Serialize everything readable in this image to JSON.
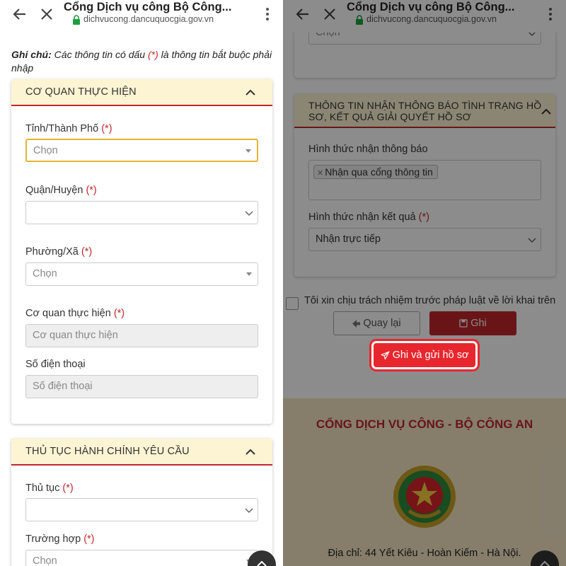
{
  "browser": {
    "title": "Cổng Dịch vụ công Bộ Công...",
    "url": "dichvucong.dancuquocgia.gov.vn"
  },
  "note": {
    "label": "Ghi chú:",
    "text_before": " Các thông tin có dấu ",
    "marker": "(*)",
    "text_after": " là thông tin bắt buộc phải nhập"
  },
  "required_marker": "(*)",
  "section_agency": {
    "title": "CƠ QUAN THỰC HIỆN",
    "province_label": "Tỉnh/Thành Phố",
    "province_placeholder": "Chọn",
    "district_label": "Quận/Huyện",
    "ward_label": "Phường/Xã",
    "ward_placeholder": "Chọn",
    "agency_label": "Cơ quan thực hiện",
    "agency_placeholder": "Cơ quan thực hiện",
    "phone_label": "Số điện thoại",
    "phone_placeholder": "Số điện thoại"
  },
  "section_procedure": {
    "title": "THỦ TỤC HÀNH CHÍNH YÊU CẦU",
    "procedure_label": "Thủ tục",
    "case_label": "Trường hợp",
    "case_placeholder": "Chọn"
  },
  "right_top_select_value": "Chọn",
  "section_notify": {
    "title_line1": "THÔNG TIN NHẬN THÔNG BÁO TÌNH TRẠNG HỒ",
    "title_line2": "SƠ, KẾT QUẢ GIẢI QUYẾT HỒ SƠ",
    "notify_method_label": "Hình thức nhận thông báo",
    "notify_tag": "Nhận qua cổng thông tin",
    "result_method_label": "Hình thức nhận kết quả",
    "result_method_value": "Nhận trực tiếp"
  },
  "agreement_text": "Tôi xin chịu trách nhiệm trước pháp luật về lời khai trên",
  "buttons": {
    "back": "Quay lại",
    "save": "Ghi",
    "save_and_submit": "Ghi và gửi hồ sơ"
  },
  "footer": {
    "title": "CỔNG DỊCH VỤ CÔNG - BỘ CÔNG AN",
    "address": "Địa chỉ: 44 Yết Kiêu - Hoàn Kiếm - Hà Nội."
  },
  "colors": {
    "accent_red": "#c0272d",
    "header_cream": "#fdf4d3",
    "focus_yellow": "#e2b333",
    "submit_red": "#e8262e"
  },
  "icons": [
    "arrow-back-icon",
    "close-icon",
    "lock-icon",
    "more-vert-icon",
    "chevron-up-icon",
    "caret-down-icon",
    "chevron-down-icon",
    "arrow-left-icon",
    "save-icon",
    "send-icon",
    "scroll-top-icon",
    "police-emblem"
  ]
}
